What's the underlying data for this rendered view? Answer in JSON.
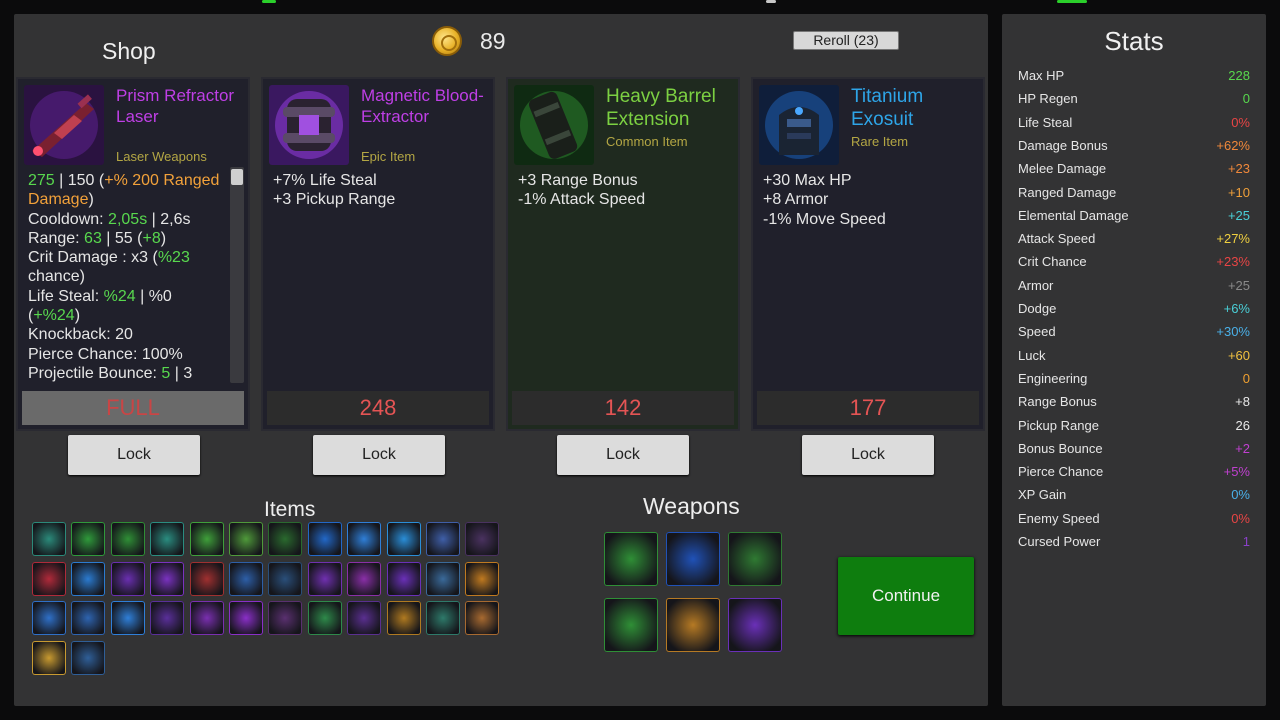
{
  "colors": {
    "epic": "#bf3fe6",
    "common": "#7cd142",
    "rare": "#2ea5e8",
    "item_type": "#b3a644",
    "legendary_type": "#b3a644",
    "positive": "#58d84e",
    "negative": "#e84545",
    "price": "#e45454"
  },
  "shop": {
    "title": "Shop",
    "coins": "89",
    "reroll_label": "Reroll (23)",
    "lock_label": "Lock",
    "cards": [
      {
        "icon": "laser-rifle-icon",
        "name": "Prism Refractor Laser",
        "subtitle": "Laser Weapons",
        "price": "FULL",
        "lines": [
          [
            {
              "t": "275",
              "c": "#58d84e"
            },
            {
              "t": " | 150 (",
              "c": "#e6e6e6"
            },
            {
              "t": "+% 200 Ranged Damage",
              "c": "#f2a13a"
            },
            {
              "t": ")",
              "c": "#e6e6e6"
            }
          ],
          [
            {
              "t": "Cooldown: ",
              "c": "#e6e6e6"
            },
            {
              "t": "2,05s",
              "c": "#58d84e"
            },
            {
              "t": " | 2,6s",
              "c": "#e6e6e6"
            }
          ],
          [
            {
              "t": "Range: ",
              "c": "#e6e6e6"
            },
            {
              "t": "63",
              "c": "#58d84e"
            },
            {
              "t": " | 55 (",
              "c": "#e6e6e6"
            },
            {
              "t": "+8",
              "c": "#58d84e"
            },
            {
              "t": ")",
              "c": "#e6e6e6"
            }
          ],
          [
            {
              "t": "Crit Damage : x3 (",
              "c": "#e6e6e6"
            },
            {
              "t": "%23",
              "c": "#58d84e"
            },
            {
              "t": " chance)",
              "c": "#e6e6e6"
            }
          ],
          [
            {
              "t": "Life Steal: ",
              "c": "#e6e6e6"
            },
            {
              "t": "%24",
              "c": "#58d84e"
            },
            {
              "t": " | %0 (",
              "c": "#e6e6e6"
            },
            {
              "t": "+%24",
              "c": "#58d84e"
            },
            {
              "t": ")",
              "c": "#e6e6e6"
            }
          ],
          [
            {
              "t": "Knockback: 20",
              "c": "#e6e6e6"
            }
          ],
          [
            {
              "t": "Pierce Chance: 100%",
              "c": "#e6e6e6"
            }
          ],
          [
            {
              "t": "Projectile Bounce: ",
              "c": "#e6e6e6"
            },
            {
              "t": "5",
              "c": "#58d84e"
            },
            {
              "t": " | 3",
              "c": "#e6e6e6"
            }
          ]
        ]
      },
      {
        "icon": "magnetic-extractor-icon",
        "name": "Magnetic Blood-Extractor",
        "subtitle": "Epic Item",
        "price": "248",
        "lines": [
          [
            {
              "t": "+7% Life Steal",
              "c": "#e6e6e6"
            }
          ],
          [
            {
              "t": "+3 Pickup Range",
              "c": "#e6e6e6"
            }
          ]
        ]
      },
      {
        "icon": "heavy-barrel-icon",
        "name": "Heavy Barrel Extension",
        "subtitle": "Common Item",
        "price": "142",
        "lines": [
          [
            {
              "t": "+3 Range Bonus",
              "c": "#e6e6e6"
            }
          ],
          [
            {
              "t": "-1% Attack Speed",
              "c": "#e6e6e6"
            }
          ]
        ]
      },
      {
        "icon": "exosuit-icon",
        "name": "Titanium Exosuit",
        "subtitle": "Rare Item",
        "price": "177",
        "lines": [
          [
            {
              "t": "+30 Max HP",
              "c": "#e6e6e6"
            }
          ],
          [
            {
              "t": "+8 Armor",
              "c": "#e6e6e6"
            }
          ],
          [
            {
              "t": "-1% Move Speed",
              "c": "#e6e6e6"
            }
          ]
        ]
      }
    ]
  },
  "items": {
    "title": "Items",
    "icons": [
      {
        "name": "item-crate-icon",
        "color": "#2b8a7a"
      },
      {
        "name": "item-drill-icon",
        "color": "#2f9a3b"
      },
      {
        "name": "item-claw-icon",
        "color": "#2f8f36"
      },
      {
        "name": "item-gear-icon",
        "color": "#2a8d80"
      },
      {
        "name": "item-canister-icon",
        "color": "#3fa03a"
      },
      {
        "name": "item-barrel-icon",
        "color": "#4f9a3a"
      },
      {
        "name": "item-rifle-icon",
        "color": "#2a6a2e"
      },
      {
        "name": "item-helmet-icon",
        "color": "#2268c8"
      },
      {
        "name": "item-tablet-icon",
        "color": "#2f7fd8"
      },
      {
        "name": "item-shield-icon",
        "color": "#2a8ed8"
      },
      {
        "name": "item-armor-icon",
        "color": "#3f5fa8"
      },
      {
        "name": "item-core-icon",
        "color": "#4a3260"
      },
      {
        "name": "item-orb-icon",
        "color": "#b02a3a"
      },
      {
        "name": "item-ring-icon",
        "color": "#2b7bd0"
      },
      {
        "name": "item-blade-icon",
        "color": "#6a2fb0"
      },
      {
        "name": "item-star-icon",
        "color": "#7a32c0"
      },
      {
        "name": "item-spike-icon",
        "color": "#a03030"
      },
      {
        "name": "item-exo-icon",
        "color": "#2d5fa8"
      },
      {
        "name": "item-chest-icon",
        "color": "#2a4f7a"
      },
      {
        "name": "item-rune-icon",
        "color": "#7030b0"
      },
      {
        "name": "item-gauntlet-icon",
        "color": "#8a2fa8"
      },
      {
        "name": "item-sphere-icon",
        "color": "#6a30b8"
      },
      {
        "name": "item-chip-icon",
        "color": "#3a6a9a"
      },
      {
        "name": "item-emblem-icon",
        "color": "#c07a20"
      },
      {
        "name": "item-pod-icon",
        "color": "#2f70c8"
      },
      {
        "name": "item-scanner-icon",
        "color": "#2e64b0"
      },
      {
        "name": "item-thruster-icon",
        "color": "#2f7fd8"
      },
      {
        "name": "item-blaster-icon",
        "color": "#5a2f9a"
      },
      {
        "name": "item-crystal-icon",
        "color": "#7a2fb0"
      },
      {
        "name": "item-shard-icon",
        "color": "#8a2fc8"
      },
      {
        "name": "item-module-icon",
        "color": "#5a3070"
      },
      {
        "name": "item-boots-icon",
        "color": "#2e8a4a"
      },
      {
        "name": "item-cube-icon",
        "color": "#5a2f90"
      },
      {
        "name": "item-bolt-icon",
        "color": "#b07a20"
      },
      {
        "name": "item-eye-icon",
        "color": "#2e7a6a"
      },
      {
        "name": "item-compass-icon",
        "color": "#a86a30"
      },
      {
        "name": "item-gold-crate-icon",
        "color": "#c89a30"
      },
      {
        "name": "item-datapad-icon",
        "color": "#2f5f98"
      }
    ]
  },
  "weapons": {
    "title": "Weapons",
    "icons": [
      {
        "name": "weapon-green-rifle-icon",
        "color": "#2f8f36"
      },
      {
        "name": "weapon-blue-laser-icon",
        "color": "#2052b8"
      },
      {
        "name": "weapon-green-shotgun-icon",
        "color": "#2f7a32"
      },
      {
        "name": "weapon-green-smg-icon",
        "color": "#2f8f36"
      },
      {
        "name": "weapon-gold-cannon-icon",
        "color": "#b67a24"
      },
      {
        "name": "weapon-purple-blaster-icon",
        "color": "#6a30b8"
      }
    ]
  },
  "continue_label": "Continue",
  "stats": {
    "title": "Stats",
    "rows": [
      {
        "label": "Max HP",
        "value": "228",
        "color": "#58d84e"
      },
      {
        "label": "HP Regen",
        "value": "0",
        "color": "#58d84e"
      },
      {
        "label": "Life Steal",
        "value": "0%",
        "color": "#e84545"
      },
      {
        "label": "Damage Bonus",
        "value": "+62%",
        "color": "#f0883a"
      },
      {
        "label": "Melee Damage",
        "value": "+23",
        "color": "#f0883a"
      },
      {
        "label": "Ranged Damage",
        "value": "+10",
        "color": "#f0a03a"
      },
      {
        "label": "Elemental Damage",
        "value": "+25",
        "color": "#4ad0d8"
      },
      {
        "label": "Attack Speed",
        "value": "+27%",
        "color": "#f0d040"
      },
      {
        "label": "Crit Chance",
        "value": "+23%",
        "color": "#e84545"
      },
      {
        "label": "Armor",
        "value": "+25",
        "color": "#8a8a8a"
      },
      {
        "label": "Dodge",
        "value": "+6%",
        "color": "#4ad0d8"
      },
      {
        "label": "Speed",
        "value": "+30%",
        "color": "#4ab0e8"
      },
      {
        "label": "Luck",
        "value": "+60",
        "color": "#f0c040"
      },
      {
        "label": "Engineering",
        "value": "0",
        "color": "#f0a030"
      },
      {
        "label": "Range Bonus",
        "value": "+8",
        "color": "#e8e8e8"
      },
      {
        "label": "Pickup Range",
        "value": "26",
        "color": "#e8e8e8"
      },
      {
        "label": "Bonus Bounce",
        "value": "+2",
        "color": "#c040d0"
      },
      {
        "label": "Pierce Chance",
        "value": "+5%",
        "color": "#c040d0"
      },
      {
        "label": "XP Gain",
        "value": "0%",
        "color": "#4ab0e8"
      },
      {
        "label": "Enemy Speed",
        "value": "0%",
        "color": "#e84545"
      },
      {
        "label": "Cursed Power",
        "value": "1",
        "color": "#8a40c8"
      }
    ]
  }
}
